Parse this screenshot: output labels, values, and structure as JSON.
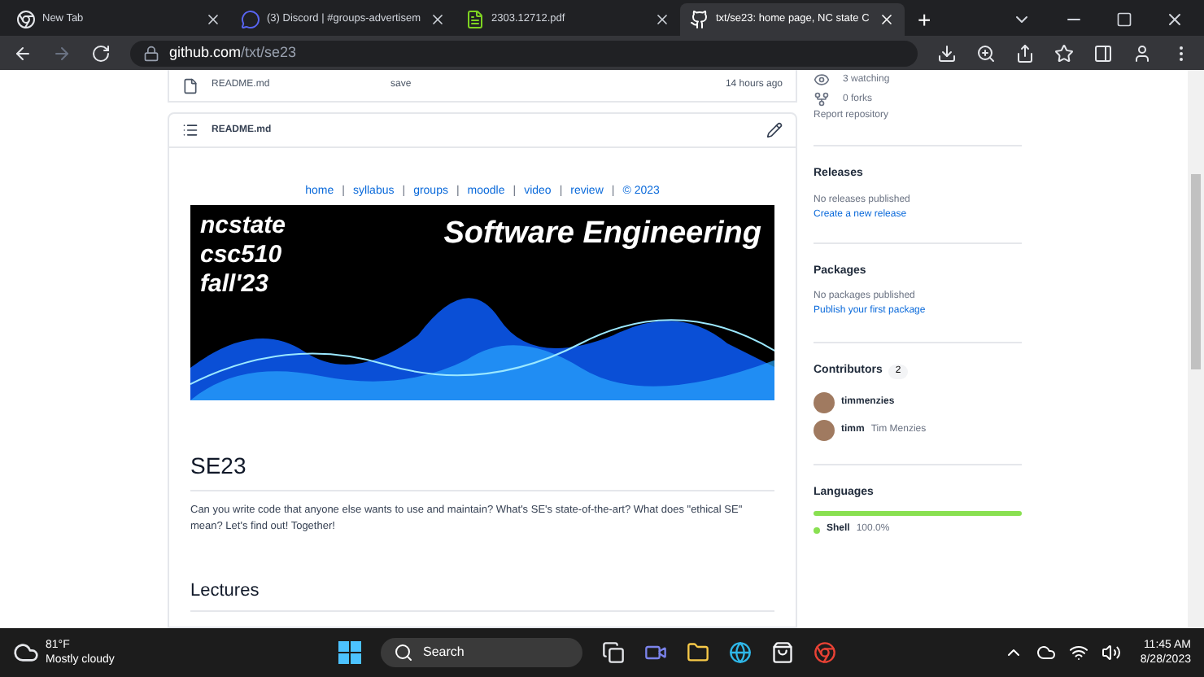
{
  "browser": {
    "tabs": [
      {
        "title": "New Tab",
        "selected": false,
        "kind": "chrome"
      },
      {
        "title": "(3) Discord | #groups-advertisem",
        "selected": false,
        "kind": "discord"
      },
      {
        "title": "2303.12712.pdf",
        "selected": false,
        "kind": "pdf"
      },
      {
        "title": "txt/se23: home page, NC state C",
        "selected": true,
        "kind": "github"
      }
    ],
    "new_tab": "+",
    "address": {
      "host": "github.com",
      "path": "/txt/se23"
    }
  },
  "file_row": {
    "name": "README.md",
    "message": "save",
    "time": "14 hours ago"
  },
  "readme": {
    "title": "README.md",
    "nav": [
      "home",
      "syllabus",
      "groups",
      "moodle",
      "video",
      "review",
      "© 2023"
    ],
    "nav_separator": "|",
    "banner": {
      "lines": [
        "ncstate",
        "csc510",
        "fall'23"
      ],
      "title": "Software Engineering"
    },
    "heading": "SE23",
    "intro": "Can you write code that anyone else wants to use and maintain? What's SE's state-of-the-art? What does \"ethical SE\" mean? Let's find out! Together!",
    "section": "Lectures"
  },
  "sidebar": {
    "stats": [
      {
        "kind": "eye",
        "text": "3 watching"
      },
      {
        "kind": "fork",
        "text": "0 forks"
      }
    ],
    "report": "Report repository",
    "releases": {
      "title": "Releases",
      "note": "No releases published",
      "link": "Create a new release"
    },
    "packages": {
      "title": "Packages",
      "note": "No packages published",
      "link": "Publish your first package"
    },
    "contributors": {
      "title": "Contributors",
      "count": "2",
      "people": [
        {
          "login": "timmenzies"
        },
        {
          "login": "timm",
          "name": "Tim Menzies"
        }
      ]
    },
    "languages": {
      "title": "Languages",
      "items": [
        {
          "name": "Shell",
          "percent": "100.0%",
          "level": 1,
          "color": "#89e051"
        }
      ]
    }
  },
  "taskbar": {
    "weather": {
      "temp": "81°F",
      "cond": "Mostly cloudy"
    },
    "search": "Search",
    "time": "11:45 AM",
    "date": "8/28/2023"
  }
}
